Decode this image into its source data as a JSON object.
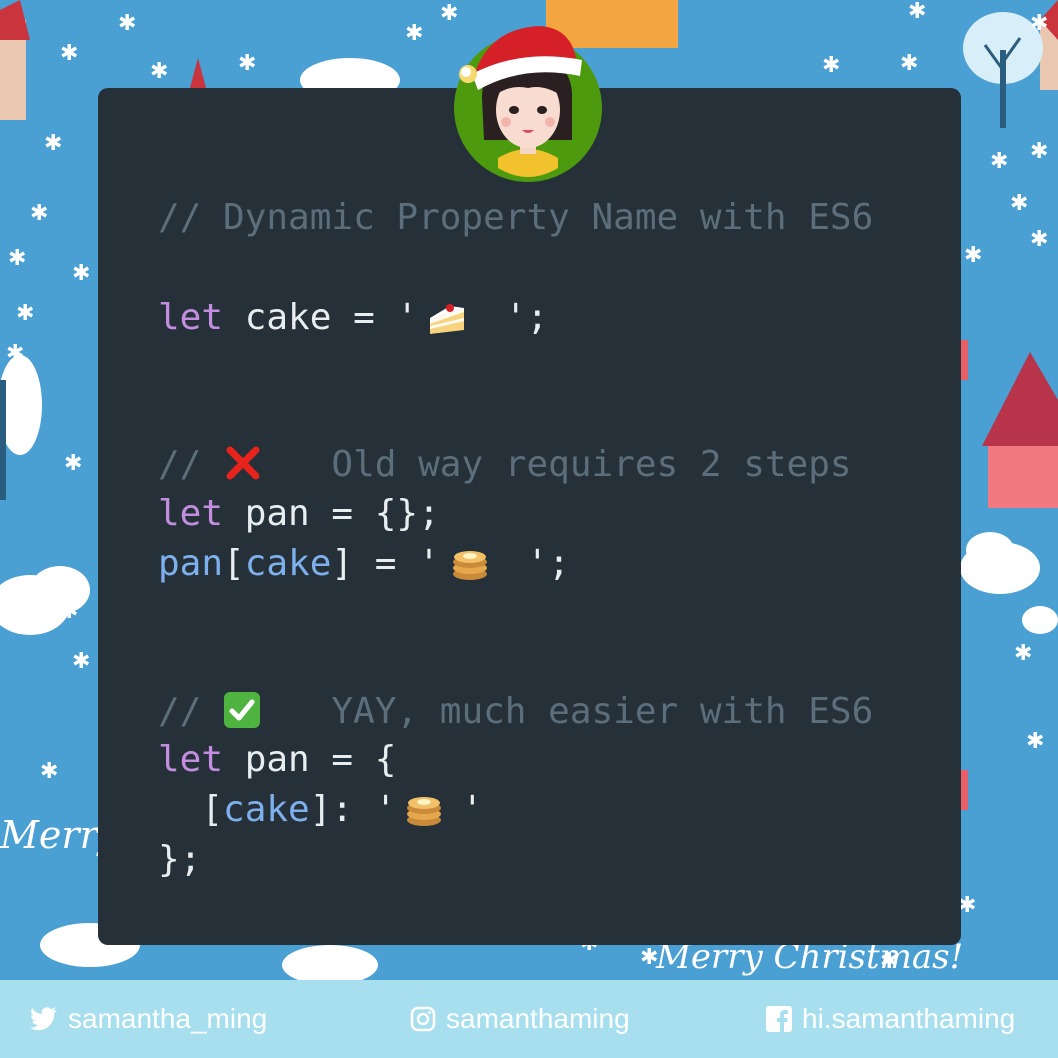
{
  "code": {
    "comment1": "// Dynamic Property Name with ES6",
    "line_cake": {
      "kw": "let",
      "rest": " cake = '",
      "tail": "';"
    },
    "comment2": "Old way requires 2 steps",
    "comment2_prefix": "//",
    "line_pan_old": {
      "kw": "let",
      "rest": " pan = {};"
    },
    "line_assign": {
      "var1": "pan",
      "b1": "[",
      "var2": "cake",
      "b2": "] = '",
      "tail": "';"
    },
    "comment3": "YAY, much easier with ES6",
    "comment3_prefix": "//",
    "line_pan_new": {
      "kw": "let",
      "rest": " pan = {"
    },
    "line_prop": {
      "b1": "  [",
      "var": "cake",
      "b2": "]: '",
      "tail": "'"
    },
    "line_close": "};"
  },
  "icons": {
    "cake": "shortcake-emoji",
    "pancakes": "pancakes-emoji",
    "cross": "cross-mark-emoji",
    "check": "check-mark-emoji"
  },
  "footer": {
    "twitter": "samantha_ming",
    "instagram": "samanthaming",
    "facebook": "hi.samanthaming"
  },
  "colors": {
    "background": "#4a9fd3",
    "card": "#263038",
    "footer": "#a8dfee",
    "comment": "#5c6e7b",
    "keyword": "#c38ee0",
    "variable": "#7fb0ee",
    "string": "#97c77a"
  }
}
